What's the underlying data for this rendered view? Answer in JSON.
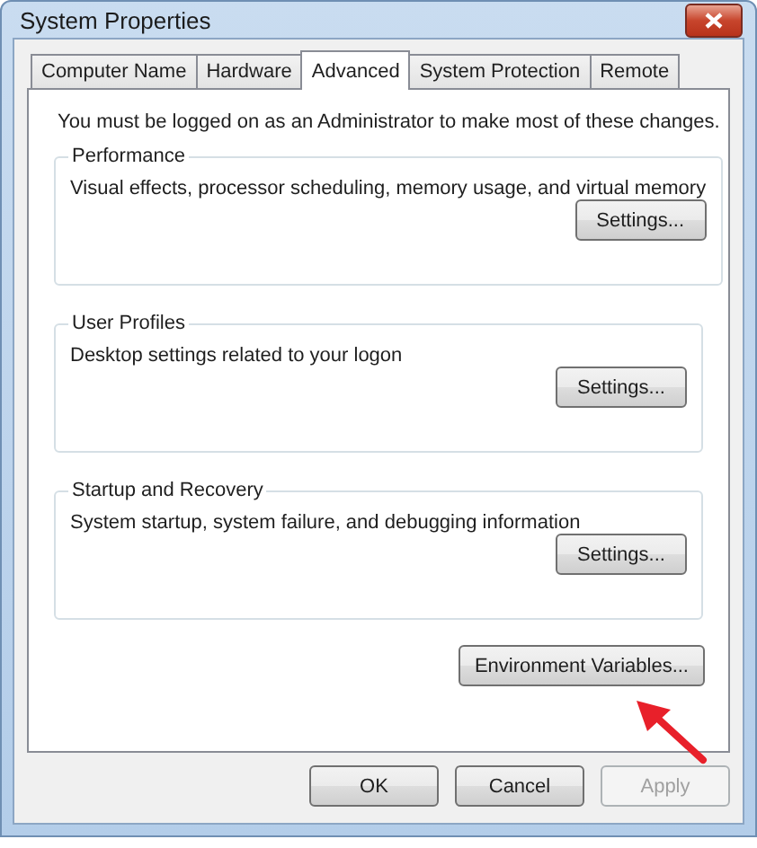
{
  "window": {
    "title": "System Properties"
  },
  "tabs": [
    {
      "label": "Computer Name",
      "selected": false
    },
    {
      "label": "Hardware",
      "selected": false
    },
    {
      "label": "Advanced",
      "selected": true
    },
    {
      "label": "System Protection",
      "selected": false
    },
    {
      "label": "Remote",
      "selected": false
    }
  ],
  "notice": "You must be logged on as an Administrator to make most of these changes.",
  "groups": [
    {
      "title": "Performance",
      "description": "Visual effects, processor scheduling, memory usage, and virtual memory",
      "button": "Settings..."
    },
    {
      "title": "User Profiles",
      "description": "Desktop settings related to your logon",
      "button": "Settings..."
    },
    {
      "title": "Startup and Recovery",
      "description": "System startup, system failure, and debugging information",
      "button": "Settings..."
    }
  ],
  "environment_button": "Environment Variables...",
  "buttons": [
    {
      "label": "OK",
      "disabled": false
    },
    {
      "label": "Cancel",
      "disabled": false
    },
    {
      "label": "Apply",
      "disabled": true
    }
  ]
}
